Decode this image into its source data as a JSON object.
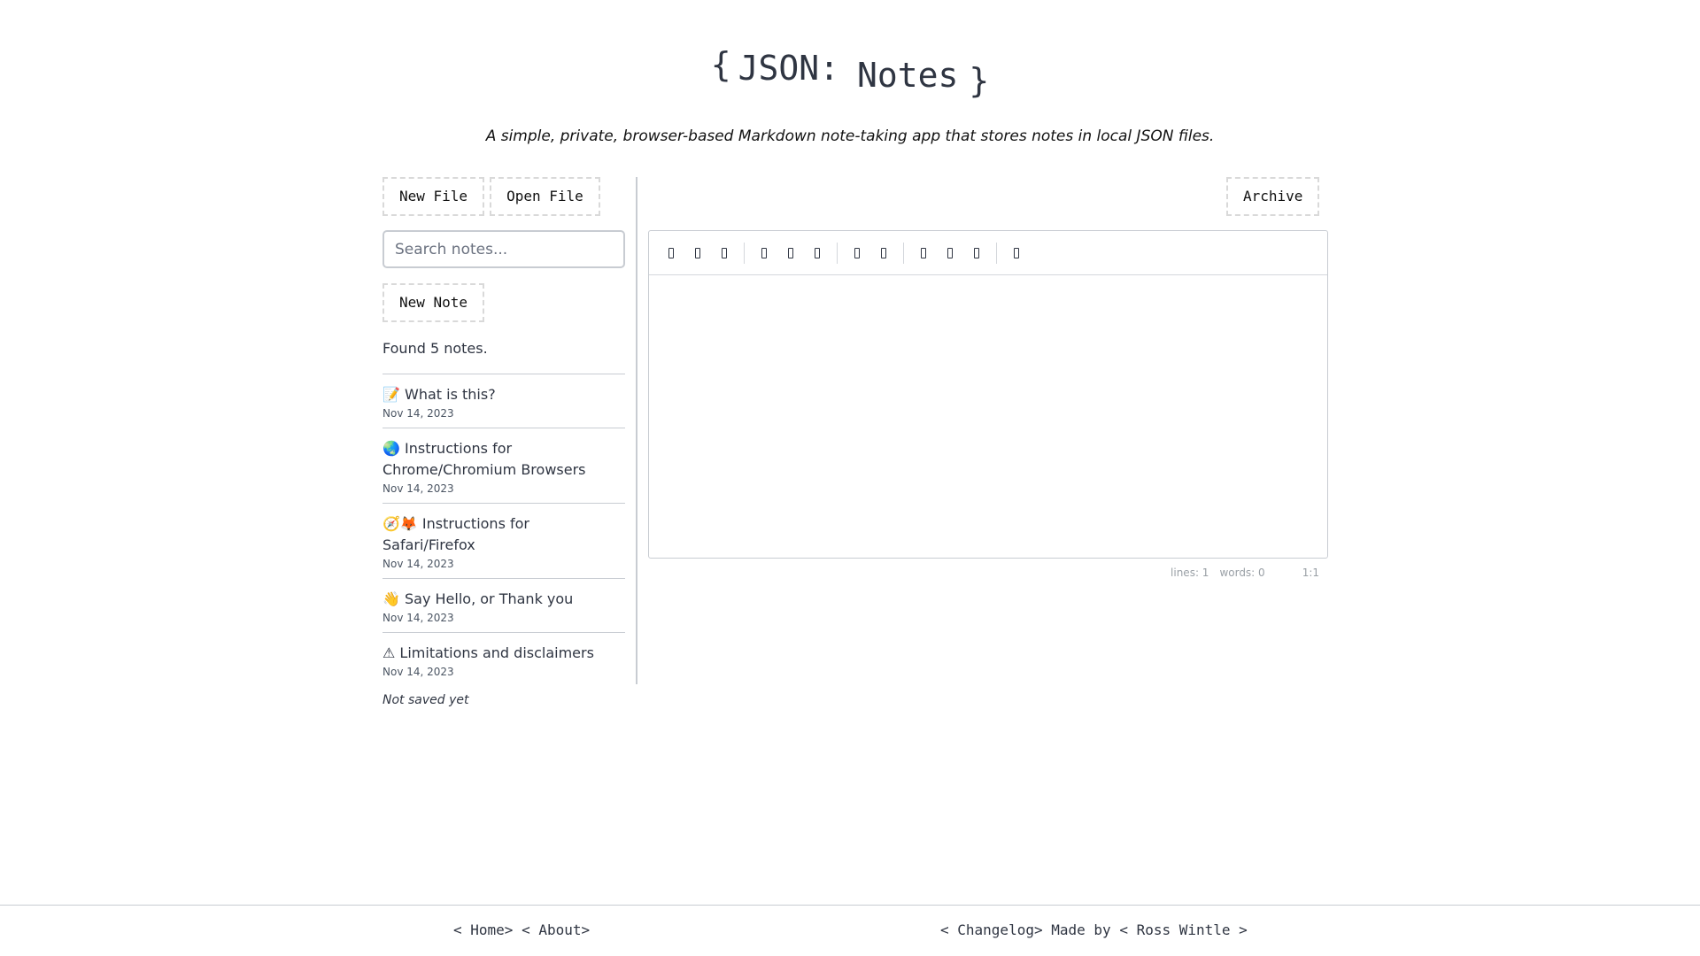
{
  "header": {
    "brace_open": "{",
    "json": "JSON:",
    "notes": "Notes",
    "brace_close": "}",
    "subtitle": "A simple, private, browser-based Markdown note-taking app that stores notes in local JSON files."
  },
  "sidebar": {
    "new_file_label": "New File",
    "open_file_label": "Open File",
    "search_placeholder": "Search notes...",
    "new_note_label": "New Note",
    "found_text": "Found 5 notes.",
    "notes": [
      {
        "title": "📝 What is this?",
        "date": "Nov 14, 2023"
      },
      {
        "title": "🌏 Instructions for Chrome/Chromium Browsers",
        "date": "Nov 14, 2023"
      },
      {
        "title": "🧭🦊 Instructions for Safari/Firefox",
        "date": "Nov 14, 2023"
      },
      {
        "title": "👋 Say Hello, or Thank you",
        "date": "Nov 14, 2023"
      },
      {
        "title": "⚠ Limitations and disclaimers",
        "date": "Nov 14, 2023"
      }
    ],
    "save_status": "Not saved yet"
  },
  "editor": {
    "archive_label": "Archive",
    "toolbar_icons": [
      "bold-icon",
      "italic-icon",
      "heading-icon",
      "quote-icon",
      "unordered-list-icon",
      "ordered-list-icon",
      "link-icon",
      "image-icon",
      "preview-icon",
      "side-by-side-icon",
      "fullscreen-icon",
      "help-icon"
    ],
    "status": {
      "lines": "lines: 1",
      "words": "words: 0",
      "cursor": "1:1"
    }
  },
  "footer": {
    "home": "< Home>",
    "about": "< About>",
    "changelog": "< Changelog>",
    "made_by": "Made by",
    "author": "< Ross Wintle >"
  }
}
